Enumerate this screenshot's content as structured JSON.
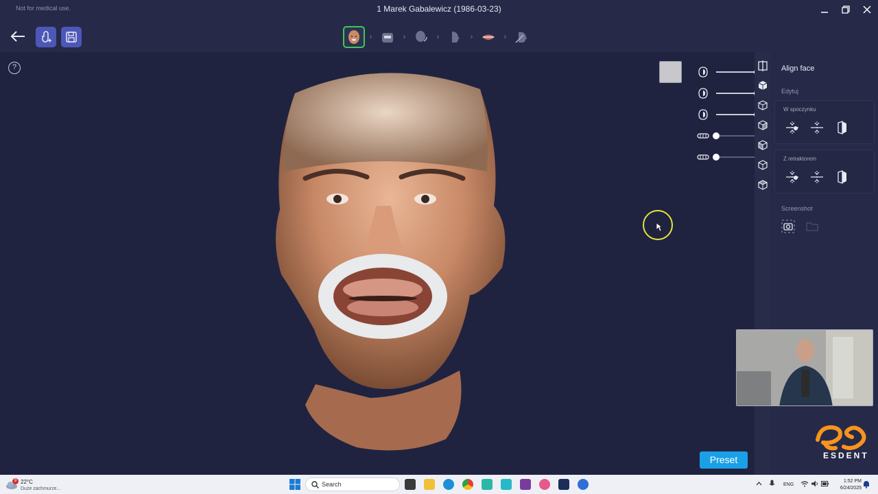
{
  "titlebar": {
    "disclaimer": "Not for medical use.",
    "title": "1 Marek Gabalewicz (1986-03-23)"
  },
  "toolbar": {
    "workflow_steps": [
      "face-scan-step",
      "upper-jaw-scan-step",
      "bite-scan-step",
      "profile-scan-step",
      "smile-step",
      "measure-step"
    ],
    "active_step": 0
  },
  "viewport": {
    "sliders": [
      {
        "icon": "face-opacity-icon",
        "level": 1.0
      },
      {
        "icon": "face-opacity-icon",
        "level": 1.0
      },
      {
        "icon": "face-opacity-icon",
        "level": 1.0
      },
      {
        "icon": "upper-teeth-icon",
        "level": 0.0
      },
      {
        "icon": "lower-teeth-icon",
        "level": 0.0
      }
    ],
    "preset_label": "Preset"
  },
  "panel": {
    "title": "Align face",
    "edit_label": "Edytuj",
    "group1_label": "W spoczynku",
    "group2_label": "Z retraktorem",
    "screenshot_label": "Screenshot"
  },
  "brand": {
    "name": "ESDENT",
    "accent": "#f7941d"
  },
  "taskbar": {
    "temperature": "22°C",
    "weather": "Duże zachmurze...",
    "weather_badge": "9",
    "search_placeholder": "Search",
    "language": "ENG",
    "time": "1:52 PM",
    "date": "6/24/2025"
  },
  "colors": {
    "background": "#1f2340",
    "toolbar": "#262a48",
    "active_step": "#3ec75a",
    "preset": "#1aa0e6"
  }
}
